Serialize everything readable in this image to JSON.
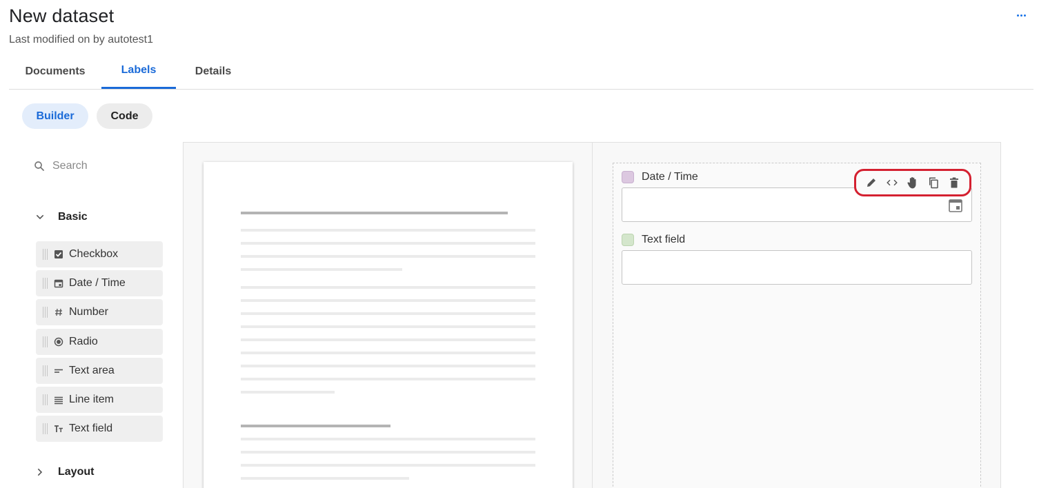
{
  "header": {
    "title": "New dataset",
    "subtitle": "Last modified on by autotest1",
    "more_icon": "more-horizontal-icon"
  },
  "tabs": [
    {
      "label": "Documents",
      "active": false
    },
    {
      "label": "Labels",
      "active": true
    },
    {
      "label": "Details",
      "active": false
    }
  ],
  "mode_toggle": {
    "builder_label": "Builder",
    "code_label": "Code",
    "selected": "Builder"
  },
  "sidebar": {
    "search_placeholder": "Search",
    "basic_section": "Basic",
    "layout_section": "Layout",
    "items": [
      {
        "label": "Checkbox",
        "icon": "checkbox-icon"
      },
      {
        "label": "Date / Time",
        "icon": "calendar-icon"
      },
      {
        "label": "Number",
        "icon": "hash-icon"
      },
      {
        "label": "Radio",
        "icon": "radio-icon"
      },
      {
        "label": "Text area",
        "icon": "text-area-icon"
      },
      {
        "label": "Line item",
        "icon": "line-item-icon"
      },
      {
        "label": "Text field",
        "icon": "text-field-icon"
      }
    ]
  },
  "form": {
    "fields": [
      {
        "label": "Date / Time",
        "color": "#dcc8e0",
        "value": ""
      },
      {
        "label": "Text field",
        "color": "#d4e6cc",
        "value": ""
      }
    ],
    "toolbar_icons": [
      "edit-icon",
      "code-icon",
      "drag-hand-icon",
      "copy-icon",
      "delete-icon"
    ]
  },
  "colors": {
    "accent": "#1a6ad8",
    "highlight_border": "#d42030"
  }
}
